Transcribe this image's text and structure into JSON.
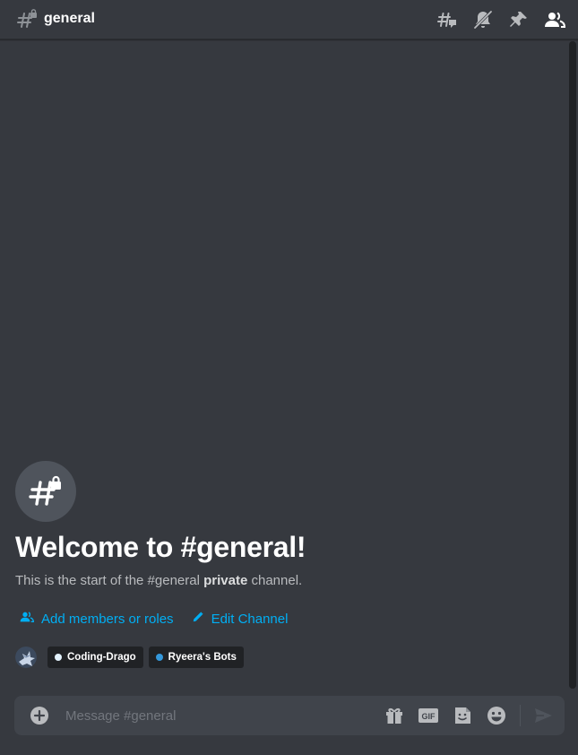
{
  "channel": {
    "name": "general"
  },
  "header": {
    "tools": [
      {
        "icon": "threads-icon"
      },
      {
        "icon": "notifications-muted-icon"
      },
      {
        "icon": "pinned-messages-icon"
      },
      {
        "icon": "member-list-icon"
      }
    ]
  },
  "welcome": {
    "title": "Welcome to #general!",
    "desc_before": "This is the start of the #general ",
    "desc_bold": "private",
    "desc_after": " channel.",
    "add_members_label": "Add members or roles",
    "edit_channel_label": "Edit Channel"
  },
  "members": {
    "tags": [
      {
        "label": "Coding-Drago",
        "dot_color": "#e3f2fd"
      },
      {
        "label": "Ryeera's Bots",
        "dot_color": "#3498db"
      }
    ]
  },
  "composer": {
    "placeholder": "Message #general"
  },
  "colors": {
    "background": "#36393f",
    "link": "#00aff4",
    "composer": "#40444b"
  }
}
